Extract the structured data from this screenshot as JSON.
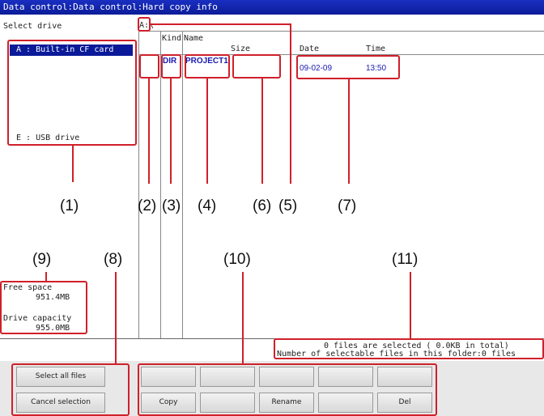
{
  "window": {
    "title": "Data control:Data control:Hard copy info"
  },
  "drive_panel": {
    "heading": "Select drive",
    "drives": [
      "A : Built-in CF card",
      "E : USB drive"
    ]
  },
  "path": "A:\\",
  "columns": {
    "kind": "Kind",
    "name": "Name",
    "size": "Size",
    "date": "Date",
    "time": "Time"
  },
  "files": [
    {
      "kind": "DIR",
      "name": "PROJECT1",
      "size": "",
      "date": "09-02-09",
      "time": "13:50"
    }
  ],
  "space": {
    "free_label": "Free space",
    "free_value": "951.4MB",
    "capacity_label": "Drive capacity",
    "capacity_value": "955.0MB"
  },
  "status": {
    "selected": "0 files are selected (    0.0KB in total)",
    "selectable": "Number of selectable files in this folder:0 files"
  },
  "buttons": {
    "select_all": "Select all files",
    "cancel_selection": "Cancel selection",
    "row1": [
      "",
      "",
      "",
      "",
      ""
    ],
    "row2": [
      "Copy",
      "",
      "Rename",
      "",
      "Del"
    ]
  },
  "callouts": [
    "(1)",
    "(2)",
    "(3)",
    "(4)",
    "(5)",
    "(6)",
    "(7)",
    "(8)",
    "(9)",
    "(10)",
    "(11)"
  ],
  "colors": {
    "title_bar": "#0b1c98",
    "selection": "#0a1a98",
    "annotation": "#d0202a",
    "file_text": "#1a1ab0"
  }
}
